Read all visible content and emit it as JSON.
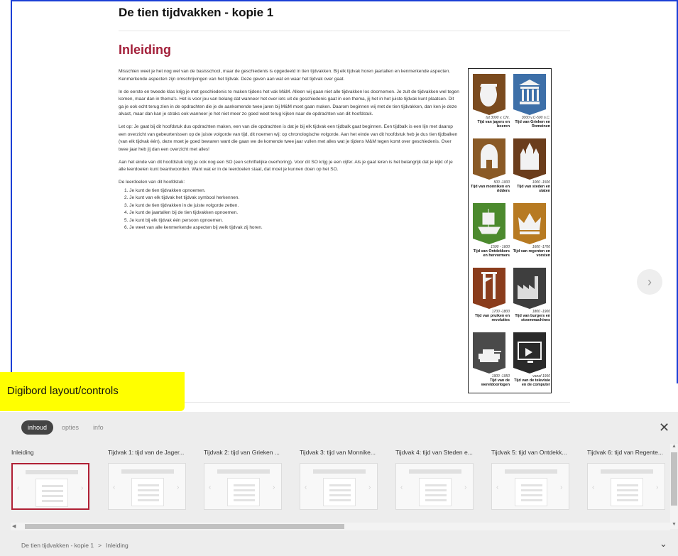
{
  "document": {
    "title": "De tien tijdvakken - kopie 1",
    "section_title": "Inleiding",
    "paragraphs": [
      "Misschien weet je het nog wel van de basisschool, maar de geschiedenis is opgedeeld in tien tijdvakken. Bij elk tijdvak horen jaartallen en kenmerkende aspecten. Kenmerkende aspecten zijn omschrijvingen van het tijdvak. Deze geven aan wat en waar het tijdvak over gaat.",
      "In de eerste en tweede klas krijg je met geschiedenis te maken tijdens het vak M&M. Alleen wij gaan niet alle tijdvakken los doornemen. Je zult de tijdvakken wel tegen komen, maar dan in thema's. Het is voor jou van belang dat wanneer het over iets uit de geschiedenis gaat in een thema, jij het in het juiste tijdvak kunt plaatsen. Dit ga je ook echt terug zien in de opdrachten die je de aankomende twee jaren bij M&M moet gaan maken. Daarom beginnen wij met de tien tijdvakken, dan ken je deze alvast, maar dan kan je straks ook wanneer je het niet meer zo goed weet terug kijken naar de opdrachten van dit hoofdstuk.",
      "Let op: Je gaat bij dit hoofdstuk dus opdrachten maken, een van die opdrachten is dat je bij elk tijdvak een tijdbalk gaat beginnen. Een tijdbalk is een lijn met daarop een overzicht van gebeurtenissen op de juiste volgorde van tijd, dit noemen wij: op chronologische volgorde. Aan het einde van dit hoofdstuk heb je dus tien tijdbalken (van elk tijdvak één), deze moet je goed bewaren want die gaan we de komende twee jaar vullen met alles wat je tijdens M&M tegen komt over geschiedenis. Over twee jaar heb jij dan een overzicht met alles!",
      "Aan het einde van dit hoofdstuk krijg je ook nog een SO (een schriftelijke overhoring). Voor dit SO krijg je een cijfer. Als je gaat leren is het belangrijk dat je kijkt of je alle leerdoelen kunt beantwoorden. Want wat er in de leerdoelen staat, dat moet je kunnen doen op het SO.",
      "De leerdoelen van dit hoofdstuk:"
    ],
    "goals": [
      "1. Je kunt de tien tijdvakken opnoemen.",
      "2. Je kunt van elk tijdvak het tijdvak symbool herkennen.",
      "3. Je kunt de tien tijdvakken in de juiste volgorde zetten.",
      "4. Je kunt de jaartallen bij de tien tijdvakken opnoemen.",
      "5. Je kunt bij elk tijdvak één persoon opnoemen.",
      "6. Je weet van alle kenmerkende aspecten bij welk tijdvak zij horen."
    ]
  },
  "timeline": [
    {
      "date": "tot 3000 v. Chr.",
      "name": "Tijd van jagers en boeren",
      "color": "#7a4a1e",
      "icon": "pot-icon"
    },
    {
      "date": "3000 v.C-500 n.C.",
      "name": "Tijd van Grieken en Romeinen",
      "color": "#3d6fa8",
      "icon": "temple-icon"
    },
    {
      "date": "500 -1000",
      "name": "Tijd van monniken en ridders",
      "color": "#8a5a26",
      "icon": "helmet-icon"
    },
    {
      "date": "1000 -1500",
      "name": "Tijd van steden en staten",
      "color": "#6b3d1c",
      "icon": "castle-icon"
    },
    {
      "date": "1500 - 1600",
      "name": "Tijd van Ontdekkers en hervormers",
      "color": "#4c8a2e",
      "icon": "ship-icon"
    },
    {
      "date": "1600 -1700",
      "name": "Tijd van regenten en vorsten",
      "color": "#b77a22",
      "icon": "crown-icon"
    },
    {
      "date": "1700 -1800",
      "name": "Tijd van pruiken en revoluties",
      "color": "#8a3c1c",
      "icon": "guillotine-icon"
    },
    {
      "date": "1800 -1900",
      "name": "Tijd van burgers en stoommachines",
      "color": "#3e3e3e",
      "icon": "factory-icon"
    },
    {
      "date": "1900 -1950",
      "name": "Tijd van de wereldoorlogen",
      "color": "#4a4a4a",
      "icon": "tank-icon"
    },
    {
      "date": "vanaf 1950",
      "name": "Tijd van de televisie en de computer",
      "color": "#2a2a2a",
      "icon": "tv-icon"
    }
  ],
  "overlay_label": "Digibord layout/controls",
  "panel": {
    "tabs": [
      "inhoud",
      "opties",
      "info"
    ],
    "thumbnails": [
      "Inleiding",
      "Tijdvak 1: tijd van de Jager...",
      "Tijdvak 2: tijd van Grieken ...",
      "Tijdvak 3: tijd van Monnike...",
      "Tijdvak 4: tijd van Steden e...",
      "Tijdvak 5: tijd van Ontdekk...",
      "Tijdvak 6: tijd van Regente..."
    ],
    "breadcrumb": [
      "De tien tijdvakken - kopie 1",
      ">",
      "Inleiding"
    ]
  }
}
